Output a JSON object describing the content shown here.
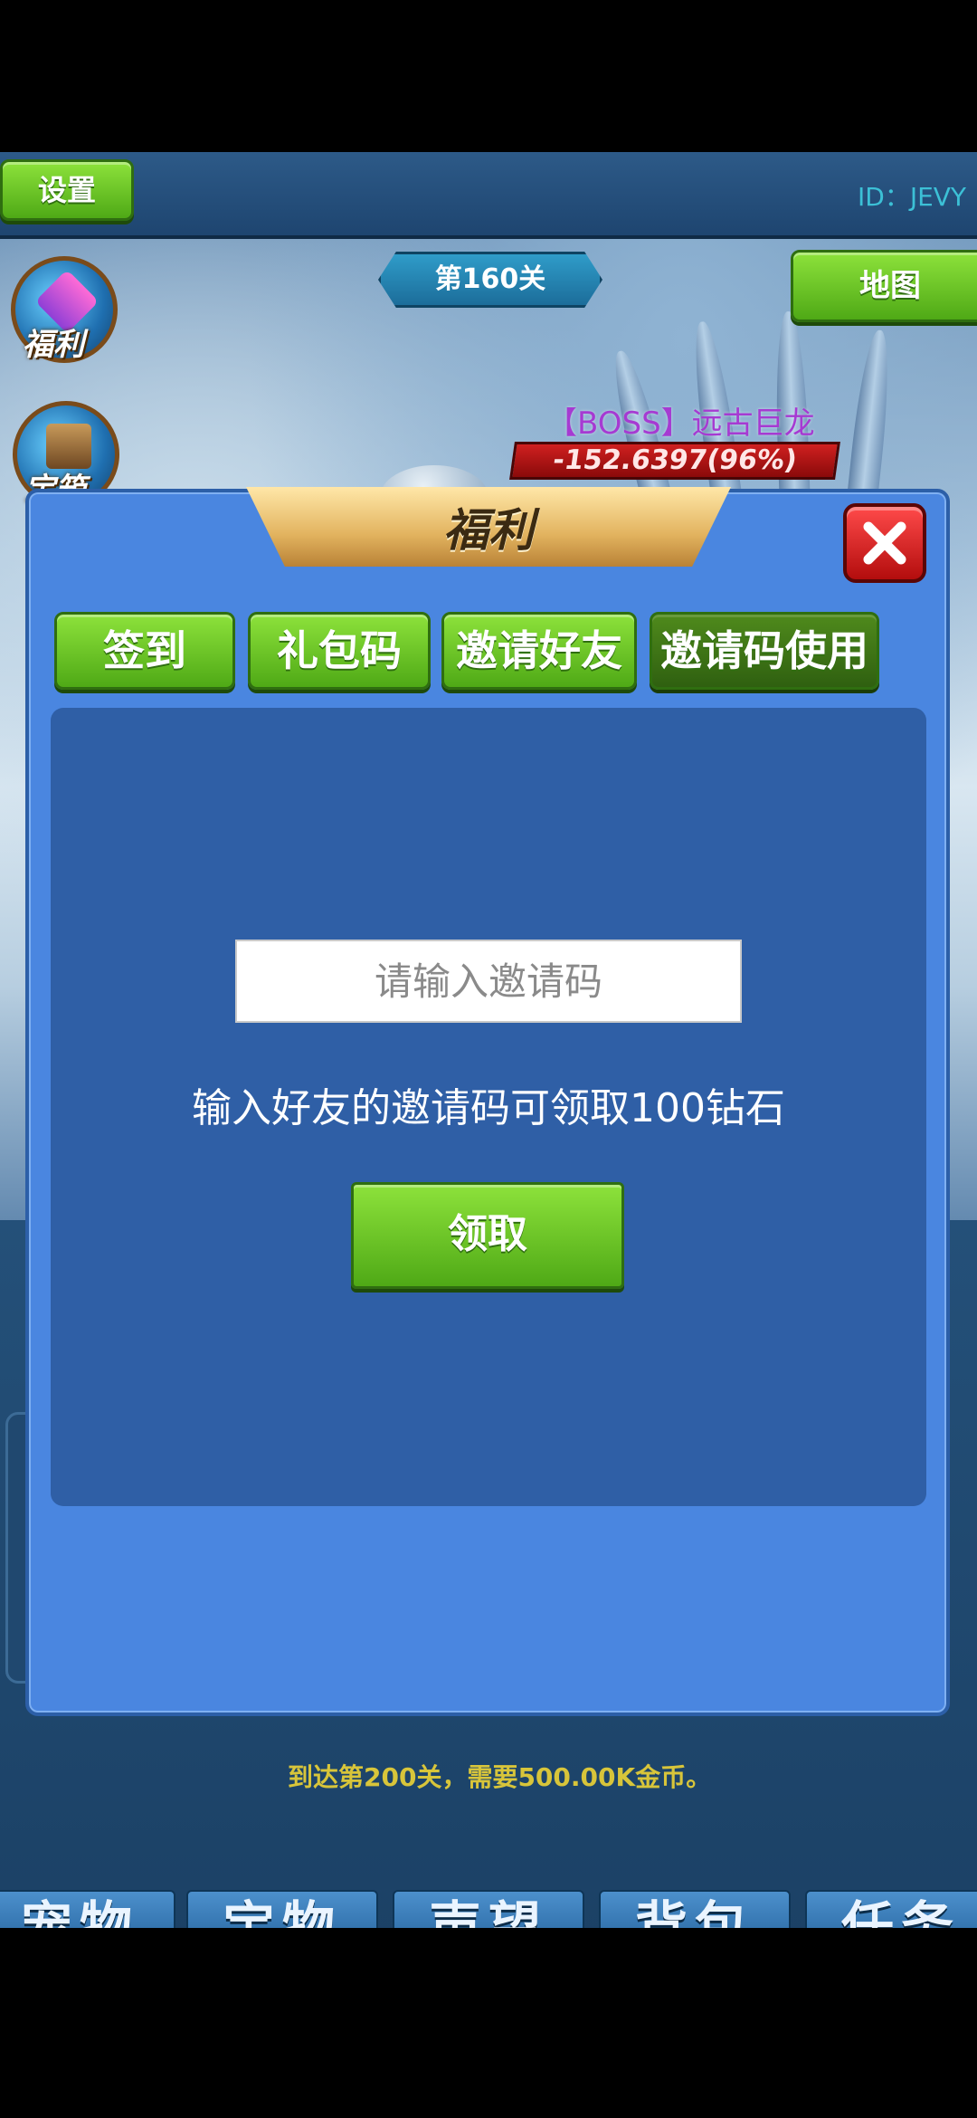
{
  "hud": {
    "settings_label": "设置",
    "player_id": "ID：JEVY",
    "map_label": "地图",
    "level_label": "第160关",
    "side_icons": [
      {
        "label": "福利",
        "icon": "gift-gems-icon"
      },
      {
        "label": "宝箱",
        "icon": "treasure-chest-icon"
      }
    ],
    "boss_name": "【BOSS】远古巨龙",
    "boss_hp": "-152.6397(96%)"
  },
  "dialog": {
    "title": "福利",
    "close_icon": "close-icon",
    "tabs": [
      {
        "label": "签到",
        "selected": false
      },
      {
        "label": "礼包码",
        "selected": false
      },
      {
        "label": "邀请好友",
        "selected": false
      },
      {
        "label": "邀请码使用",
        "selected": true
      }
    ],
    "invite_input": {
      "value": "",
      "placeholder": "请输入邀请码"
    },
    "description": "输入好友的邀请码可领取100钻石",
    "claim_label": "领取"
  },
  "underlying": {
    "stage_hint": "到达第200关，需要500.00K金币。"
  },
  "bottom_nav": [
    "宠物",
    "宝物",
    "声望",
    "背包",
    "任务"
  ],
  "colors": {
    "dialog_bg": "#4a86e0",
    "panel_bg": "#2f5fa6",
    "button_green": "#6cc62a",
    "button_selected": "#3f7716",
    "close_red": "#d91c1c",
    "boss_name": "#a63ad2",
    "hint_text": "#d8c53a"
  }
}
